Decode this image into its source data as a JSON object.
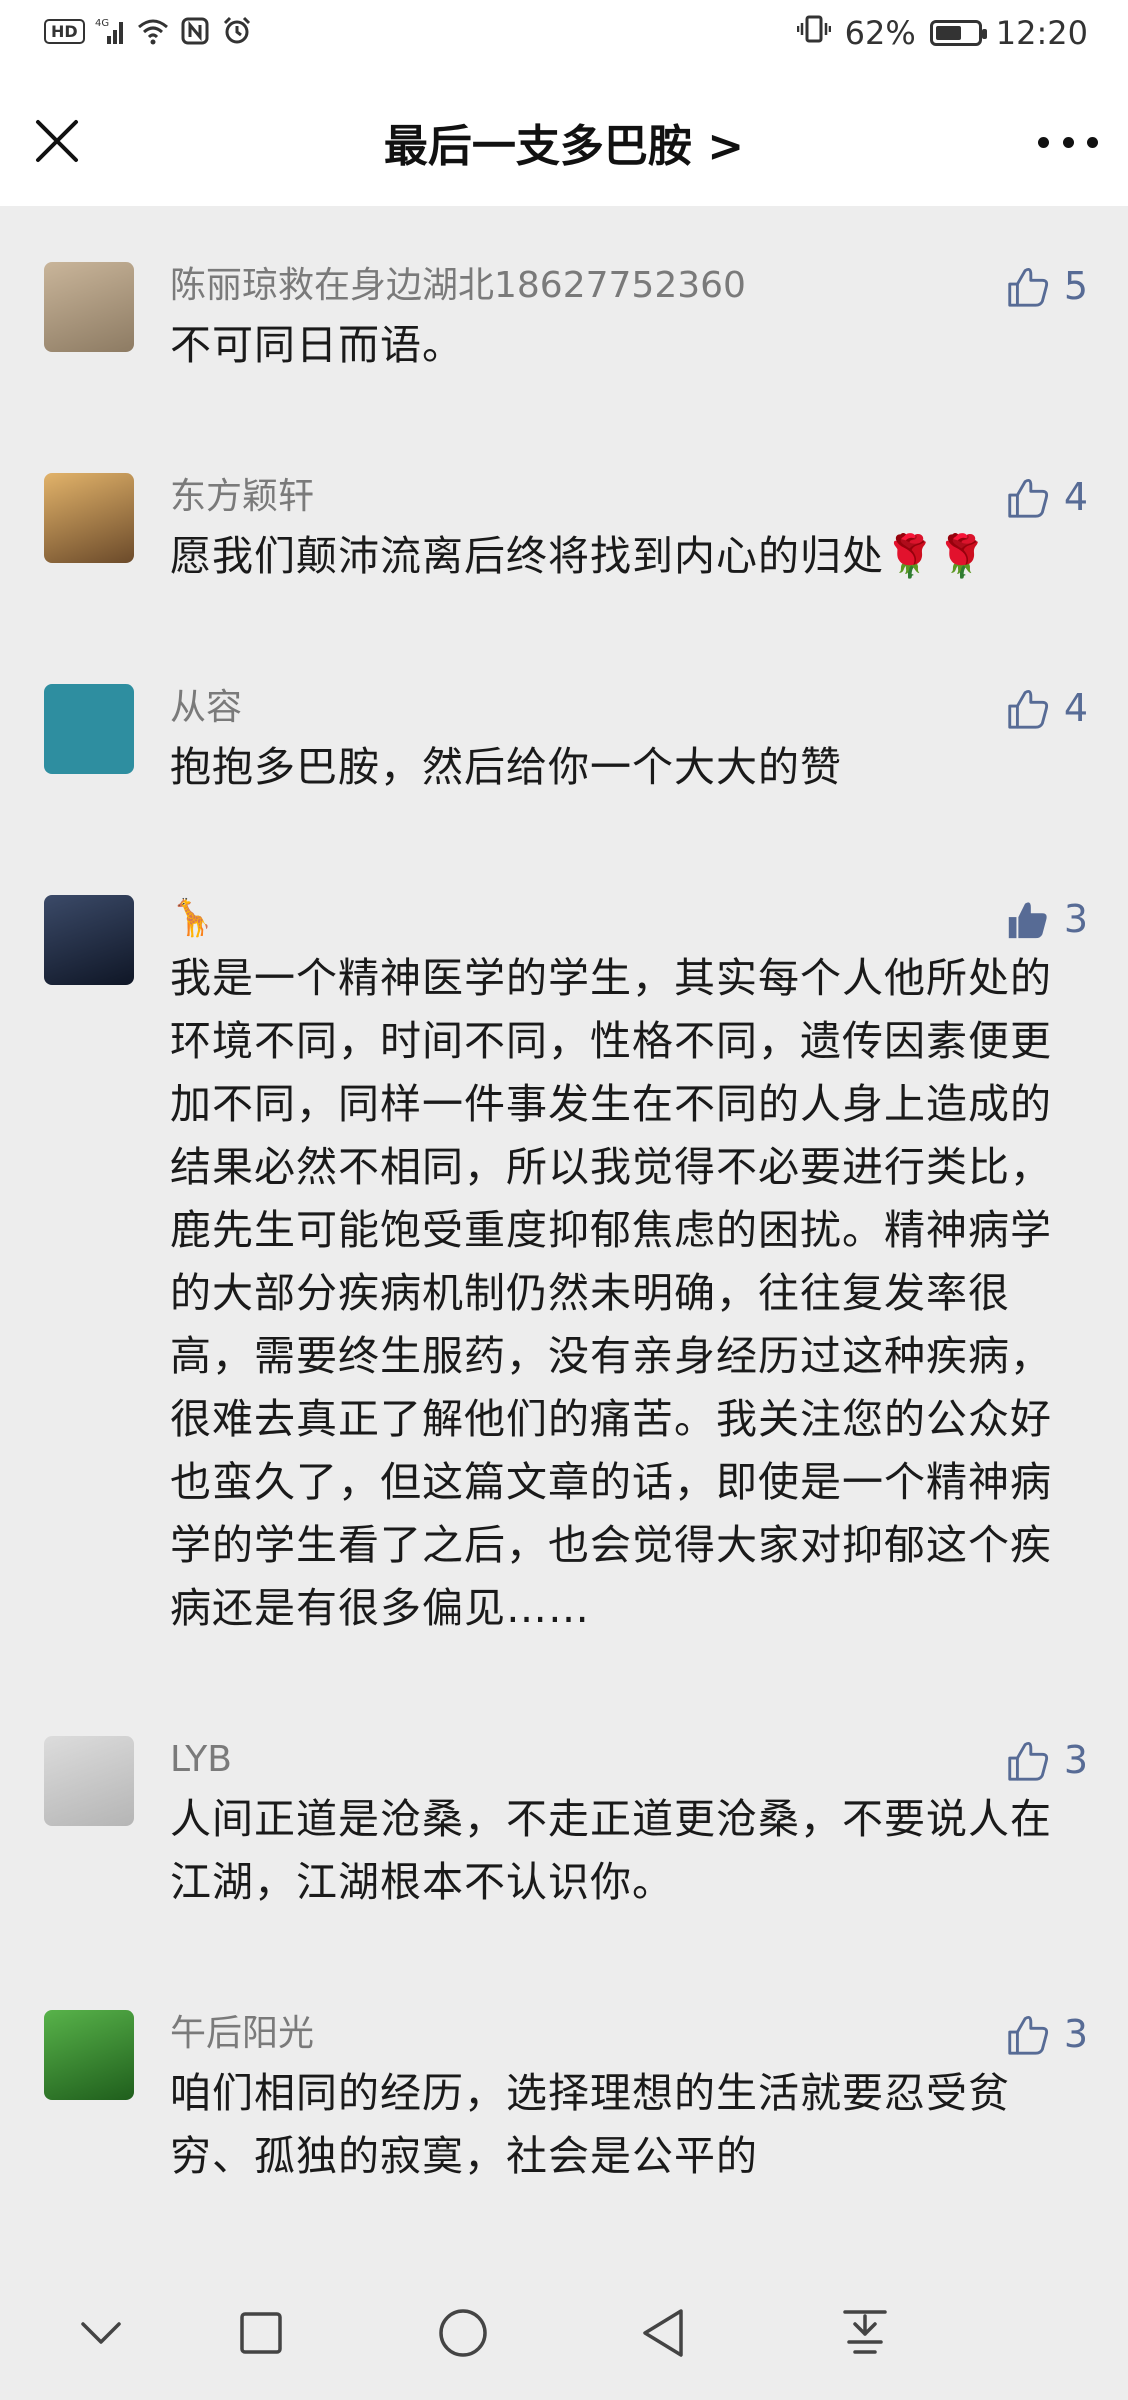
{
  "status_bar": {
    "hd_label": "HD",
    "network_label": "4G",
    "battery_percent": "62%",
    "battery_level": 0.62,
    "time": "12:20",
    "icons": [
      "hd-icon",
      "signal-icon",
      "wifi-icon",
      "nfc-icon",
      "alarm-icon",
      "vibrate-icon",
      "battery-icon"
    ]
  },
  "header": {
    "title": "最后一支多巴胺 >",
    "close_icon": "close-icon",
    "more_icon": "more-icon"
  },
  "comments": [
    {
      "name": "陈丽琼救在身边湖北18627752360",
      "likes": "5",
      "liked": false,
      "content": "不可同日而语。",
      "avatar_colors": [
        "#c9b59a",
        "#8d7b63"
      ]
    },
    {
      "name": "东方颖轩",
      "likes": "4",
      "liked": false,
      "content": "愿我们颠沛流离后终将找到内心的归处🌹🌹",
      "avatar_colors": [
        "#e2b36a",
        "#6b4a2a"
      ]
    },
    {
      "name": "从容",
      "likes": "4",
      "liked": false,
      "content": "抱抱多巴胺，然后给你一个大大的赞",
      "avatar_colors": [
        "#2e8ea0",
        "#2e8ea0"
      ]
    },
    {
      "name": "🦒",
      "likes": "3",
      "liked": true,
      "content": "我是一个精神医学的学生，其实每个人他所处的环境不同，时间不同，性格不同，遗传因素便更加不同，同样一件事发生在不同的人身上造成的结果必然不相同，所以我觉得不必要进行类比，鹿先生可能饱受重度抑郁焦虑的困扰。精神病学的大部分疾病机制仍然未明确，往往复发率很高，需要终生服药，没有亲身经历过这种疾病，很难去真正了解他们的痛苦。我关注您的公众好也蛮久了，但这篇文章的话，即使是一个精神病学的学生看了之后，也会觉得大家对抑郁这个疾病还是有很多偏见……",
      "avatar_colors": [
        "#3b4a68",
        "#0f1626"
      ]
    },
    {
      "name": "LYB",
      "likes": "3",
      "liked": false,
      "content": "人间正道是沧桑，不走正道更沧桑，不要说人在江湖，江湖根本不认识你。",
      "avatar_colors": [
        "#dcdcdc",
        "#b5b5b5"
      ]
    },
    {
      "name": "午后阳光",
      "likes": "3",
      "liked": false,
      "content": "咱们相同的经历，选择理想的生活就要忍受贫穷、孤独的寂寞，社会是公平的",
      "avatar_colors": [
        "#58b34a",
        "#1f5e1c"
      ]
    }
  ],
  "nav_bar": {
    "icons": [
      "chevron-down-icon",
      "recents-icon",
      "home-icon",
      "back-icon",
      "notification-pull-icon"
    ]
  }
}
